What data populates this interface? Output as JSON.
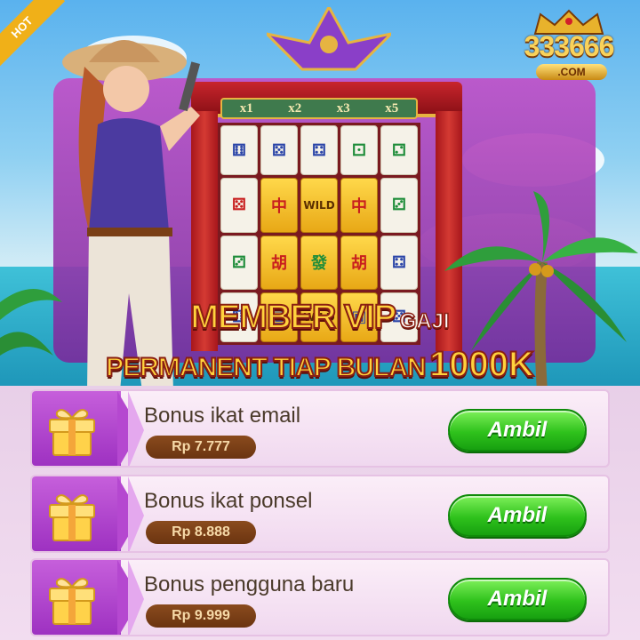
{
  "banner": {
    "hot_label": "HOT",
    "multipliers": [
      "x1",
      "x2",
      "x3",
      "x5"
    ],
    "wild_label": "WILD",
    "headline": {
      "line1_big": "MEMBER VIP",
      "line1_small": "GAJI",
      "line2_text": "PERMANENT TIAP BULAN",
      "line2_amount": "1000K"
    }
  },
  "logo": {
    "number": "333666",
    "domain": ".COM"
  },
  "bonuses": [
    {
      "title": "Bonus ikat email",
      "amount": "Rp 7.777",
      "button": "Ambil"
    },
    {
      "title": "Bonus ikat ponsel",
      "amount": "Rp 8.888",
      "button": "Ambil"
    },
    {
      "title": "Bonus pengguna baru",
      "amount": "Rp 9.999",
      "button": "Ambil"
    }
  ],
  "colors": {
    "claim_button": "#2fc21c",
    "amount_pill": "#7a3f16",
    "gift_block": "#b548d0",
    "headline_gold": "#ffd23d"
  }
}
